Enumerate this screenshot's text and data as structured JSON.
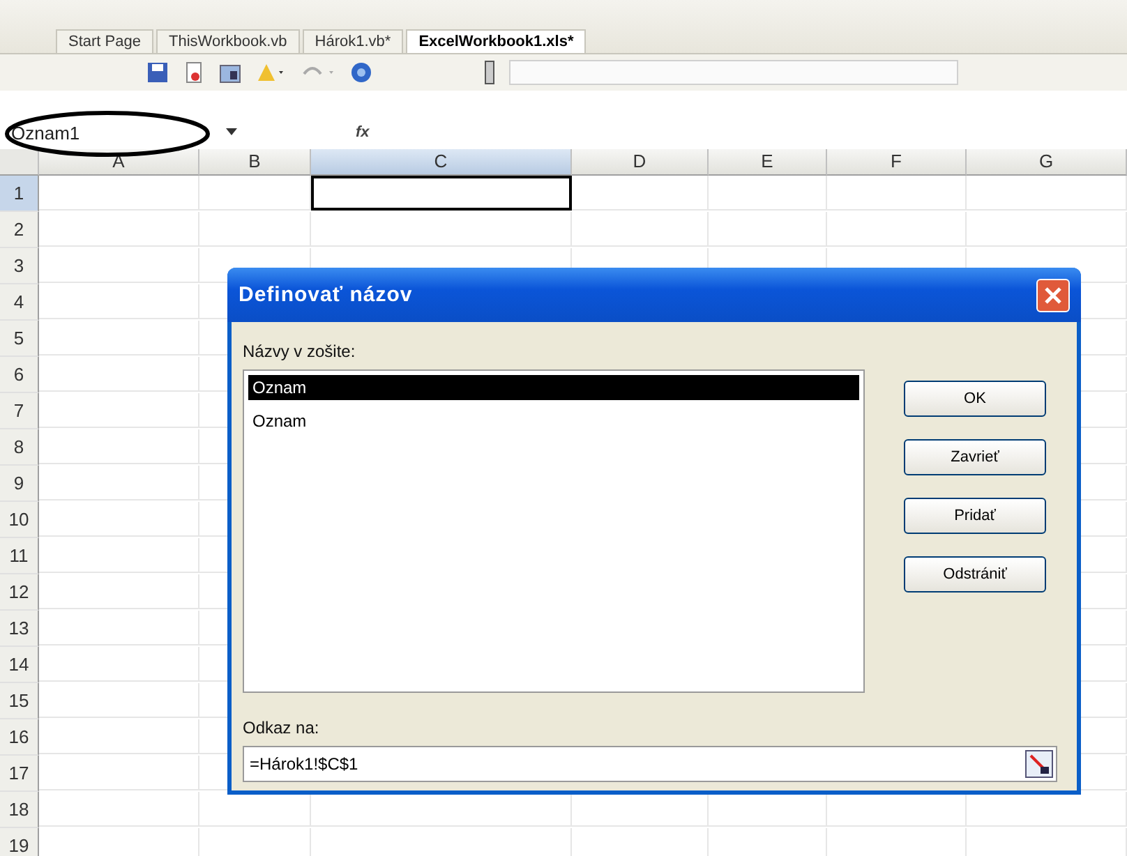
{
  "doc_tabs": [
    {
      "label": "Start Page",
      "selected": false
    },
    {
      "label": "ThisWorkbook.vb",
      "selected": false
    },
    {
      "label": "Hárok1.vb*",
      "selected": false
    },
    {
      "label": "ExcelWorkbook1.xls*",
      "selected": true
    }
  ],
  "formula_bar": {
    "name_box": "Oznam1",
    "fx": "fx"
  },
  "columns": [
    {
      "label": "A",
      "selected": false
    },
    {
      "label": "B",
      "selected": false
    },
    {
      "label": "C",
      "selected": true
    },
    {
      "label": "D",
      "selected": false
    },
    {
      "label": "E",
      "selected": false
    },
    {
      "label": "F",
      "selected": false
    },
    {
      "label": "G",
      "selected": false
    }
  ],
  "rows": [
    {
      "label": "1",
      "selected": true
    },
    {
      "label": "2",
      "selected": false
    },
    {
      "label": "3",
      "selected": false
    },
    {
      "label": "4",
      "selected": false
    },
    {
      "label": "5",
      "selected": false
    },
    {
      "label": "6",
      "selected": false
    },
    {
      "label": "7",
      "selected": false
    },
    {
      "label": "8",
      "selected": false
    },
    {
      "label": "9",
      "selected": false
    },
    {
      "label": "10",
      "selected": false
    },
    {
      "label": "11",
      "selected": false
    },
    {
      "label": "12",
      "selected": false
    },
    {
      "label": "13",
      "selected": false
    },
    {
      "label": "14",
      "selected": false
    },
    {
      "label": "15",
      "selected": false
    },
    {
      "label": "16",
      "selected": false
    },
    {
      "label": "17",
      "selected": false
    },
    {
      "label": "18",
      "selected": false
    },
    {
      "label": "19",
      "selected": false
    }
  ],
  "dialog": {
    "title": "Definovať názov",
    "names_label": "Názvy v zošite:",
    "names": [
      {
        "label": "Oznam",
        "selected": true
      },
      {
        "label": "Oznam",
        "selected": false
      }
    ],
    "buttons": [
      "OK",
      "Zavrieť",
      "Pridať",
      "Odstrániť"
    ],
    "ref_label": "Odkaz na:",
    "ref_value": "=Hárok1!$C$1"
  }
}
